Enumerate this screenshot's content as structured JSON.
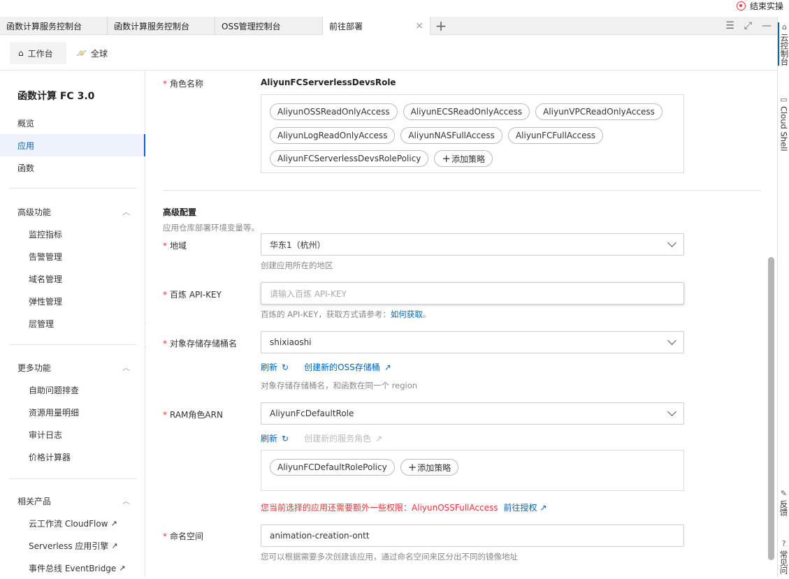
{
  "topbar": {
    "end_label": "结束实操"
  },
  "tabs": [
    {
      "label": "函数计算服务控制台"
    },
    {
      "label": "函数计算服务控制台"
    },
    {
      "label": "OSS管理控制台"
    },
    {
      "label": "前往部署",
      "active": true,
      "close": "×"
    }
  ],
  "tab_plus": "+",
  "nav": {
    "workbench": "工作台",
    "global": "全球"
  },
  "sidebar": {
    "title": "函数计算 FC 3.0",
    "items": [
      "概览",
      "应用",
      "函数"
    ],
    "active_item": "应用",
    "groups": [
      {
        "title": "高级功能",
        "items": [
          "监控指标",
          "告警管理",
          "域名管理",
          "弹性管理",
          "层管理"
        ]
      },
      {
        "title": "更多功能",
        "items": [
          "自助问题排查",
          "资源用量明细",
          "审计日志",
          "价格计算器"
        ]
      },
      {
        "title": "相关产品",
        "items": [
          "云工作流 CloudFlow",
          "Serverless 应用引擎",
          "事件总线 EventBridge"
        ]
      }
    ]
  },
  "form": {
    "role_name": {
      "label": "角色名称",
      "value": "AliyunFCServerlessDevsRole"
    },
    "role_policies": [
      "AliyunOSSReadOnlyAccess",
      "AliyunECSReadOnlyAccess",
      "AliyunVPCReadOnlyAccess",
      "AliyunLogReadOnlyAccess",
      "AliyunNASFullAccess",
      "AliyunFCFullAccess",
      "AliyunFCServerlessDevsRolePolicy"
    ],
    "add_policy": "添加策略",
    "advanced": {
      "title": "高级配置",
      "desc": "应用仓库部署环境变量等。"
    },
    "region": {
      "label": "地域",
      "value": "华东1（杭州）",
      "hint": "创建应用所在的地区"
    },
    "api_key": {
      "label": "百炼 API-KEY",
      "placeholder": "请输入百炼 API-KEY",
      "hint_text": "百炼的 API-KEY，获取方式请参考：",
      "hint_link": "如何获取",
      "hint_end": "。"
    },
    "bucket": {
      "label": "对象存储存储桶名",
      "value": "shixiaoshi",
      "refresh": "刷新",
      "create": "创建新的OSS存储桶",
      "hint": "对象存储存储桶名，和函数在同一个 region"
    },
    "ram": {
      "label": "RAM角色ARN",
      "value": "AliyunFcDefaultRole",
      "refresh": "刷新",
      "create": "创建新的服务角色",
      "policies": [
        "AliyunFCDefaultRolePolicy"
      ],
      "add_policy": "添加策略",
      "warn": "您当前选择的应用还需要额外一些权限：AliyunOSSFullAccess",
      "warn_link": "前往授权"
    },
    "namespace": {
      "label": "命名空间",
      "value": "animation-creation-ontt",
      "hint": "您可以根据需要多次创建该应用，通过命名空间来区分出不同的镜像地址"
    }
  },
  "rightbar": {
    "console": "云控制台",
    "shell": "Cloud Shell",
    "feedback": "反馈",
    "faq": "常见问"
  }
}
